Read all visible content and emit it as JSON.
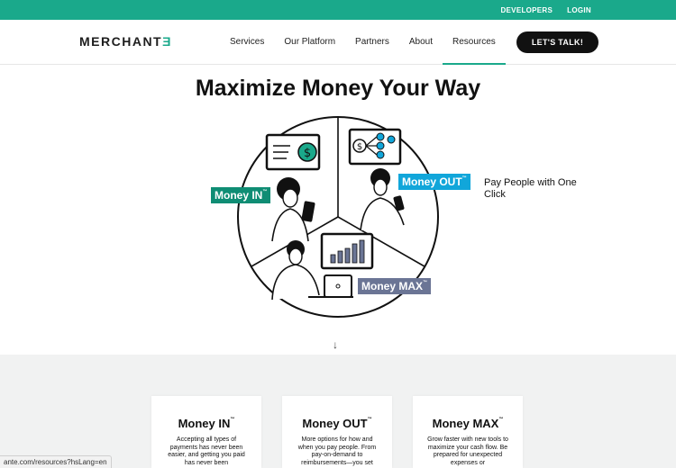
{
  "topbar": {
    "developers": "DEVELOPERS",
    "login": "LOGIN"
  },
  "nav": {
    "logo_main": "MERCHANT",
    "logo_accent": "Ǝ",
    "items": [
      "Services",
      "Our Platform",
      "Partners",
      "About",
      "Resources"
    ],
    "active": "Resources",
    "cta": "LET'S TALK!"
  },
  "hero": {
    "title": "Maximize Money Your Way",
    "labels": {
      "in": "Money IN",
      "out": "Money OUT",
      "max": "Money MAX",
      "tm": "™"
    },
    "side_text": "Pay People with One Click"
  },
  "arrow": "↓",
  "cards": [
    {
      "title": "Money IN",
      "tm": "™",
      "text": "Accepting all types of payments has never been easier, and getting you paid has never been"
    },
    {
      "title": "Money OUT",
      "tm": "™",
      "text": "More options for how and when you pay people. From pay-on-demand to reimbursements—you set"
    },
    {
      "title": "Money MAX",
      "tm": "™",
      "text": "Grow faster with new tools to maximize your cash flow. Be prepared for unexpected expenses or"
    }
  ],
  "status_url": "ante.com/resources?hsLang=en",
  "colors": {
    "brand_green": "#1aa98b",
    "money_in": "#0f8d74",
    "money_out": "#11a6da",
    "money_max": "#6b7595"
  }
}
